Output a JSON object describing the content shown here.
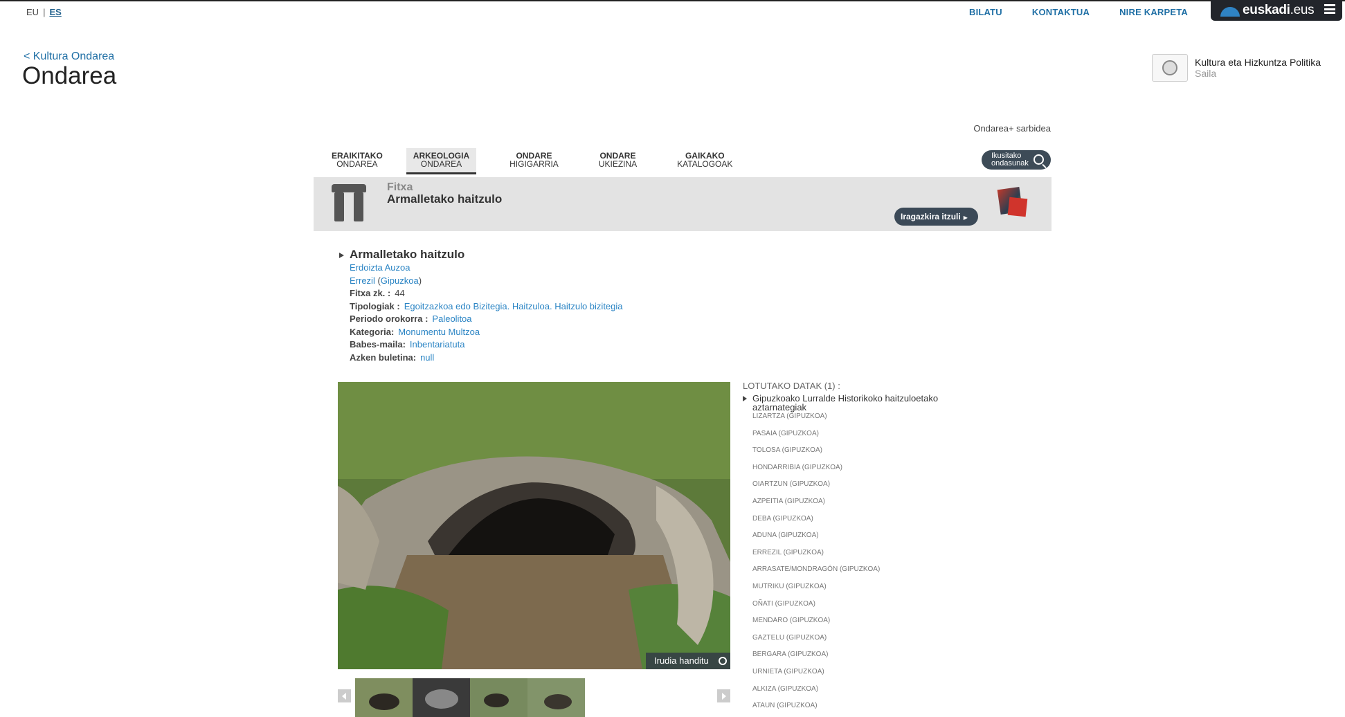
{
  "lang": {
    "eu": "EU",
    "es": "ES"
  },
  "topnav": {
    "bilatu": "BILATU",
    "kontaktua": "KONTAKTUA",
    "karpeta": "NIRE KARPETA"
  },
  "brand": {
    "bold": "euskadi",
    "rest": ".eus"
  },
  "header": {
    "back": "< Kultura Ondarea",
    "title": "Ondarea",
    "dept_main": "Kultura eta Hizkuntza Politika",
    "dept_sub": " Saila"
  },
  "sarbidea": "Ondarea+ sarbidea",
  "tabs": [
    {
      "l1": "ERAIKITAKO",
      "l2": "ONDAREA"
    },
    {
      "l1": "ARKEOLOGIA",
      "l2": "ONDAREA"
    },
    {
      "l1": "ONDARE",
      "l2": "HIGIGARRIA"
    },
    {
      "l1": "ONDARE",
      "l2": "UKIEZINA"
    },
    {
      "l1": "GAIKAKO",
      "l2": "KATALOGOAK"
    }
  ],
  "ikusitako": {
    "l1": "Ikusitako",
    "l2": "ondasunak"
  },
  "fitxa": {
    "label": "Fitxa",
    "name": "Armalletako haitzulo",
    "back_button": "Iragazkira itzuli"
  },
  "details": {
    "title": "Armalletako haitzulo",
    "neighborhood": "Erdoizta Auzoa",
    "town": "Errezil",
    "province": "Gipuzkoa",
    "rows": [
      {
        "key": "Fitxa zk. :",
        "value": "44"
      },
      {
        "key": "Tipologiak :",
        "value": "Egoitzazkoa edo Bizitegia. Haitzuloa. Haitzulo bizitegia"
      },
      {
        "key": "Periodo orokorra :",
        "value": "Paleolitoa"
      },
      {
        "key": "Kategoria:",
        "value": "Monumentu Multzoa"
      },
      {
        "key": "Babes-maila:",
        "value": "Inbentariatuta"
      },
      {
        "key": "Azken buletina:",
        "value": "null"
      }
    ]
  },
  "photo": {
    "zoom_label": "Irudia handitu"
  },
  "lotutako": {
    "head": "LOTUTAKO DATAK (1) :",
    "group": "Gipuzkoako Lurralde Historikoko haitzuloetako aztarnategiak",
    "locations": [
      "LIZARTZA (GIPUZKOA)",
      "PASAIA (GIPUZKOA)",
      "TOLOSA (GIPUZKOA)",
      "HONDARRIBIA (GIPUZKOA)",
      "OIARTZUN (GIPUZKOA)",
      "AZPEITIA (GIPUZKOA)",
      "DEBA (GIPUZKOA)",
      "ADUNA (GIPUZKOA)",
      "ERREZIL (GIPUZKOA)",
      "ARRASATE/MONDRAGÓN (GIPUZKOA)",
      "MUTRIKU (GIPUZKOA)",
      "OÑATI (GIPUZKOA)",
      "MENDARO (GIPUZKOA)",
      "GAZTELU (GIPUZKOA)",
      "BERGARA (GIPUZKOA)",
      "URNIETA (GIPUZKOA)",
      "ALKIZA (GIPUZKOA)",
      "ATAUN (GIPUZKOA)"
    ]
  },
  "colors": {
    "link": "#2a84c4",
    "nav": "#1f6fa5",
    "brand_bg": "#22252b",
    "button_bg": "#3b4957"
  }
}
